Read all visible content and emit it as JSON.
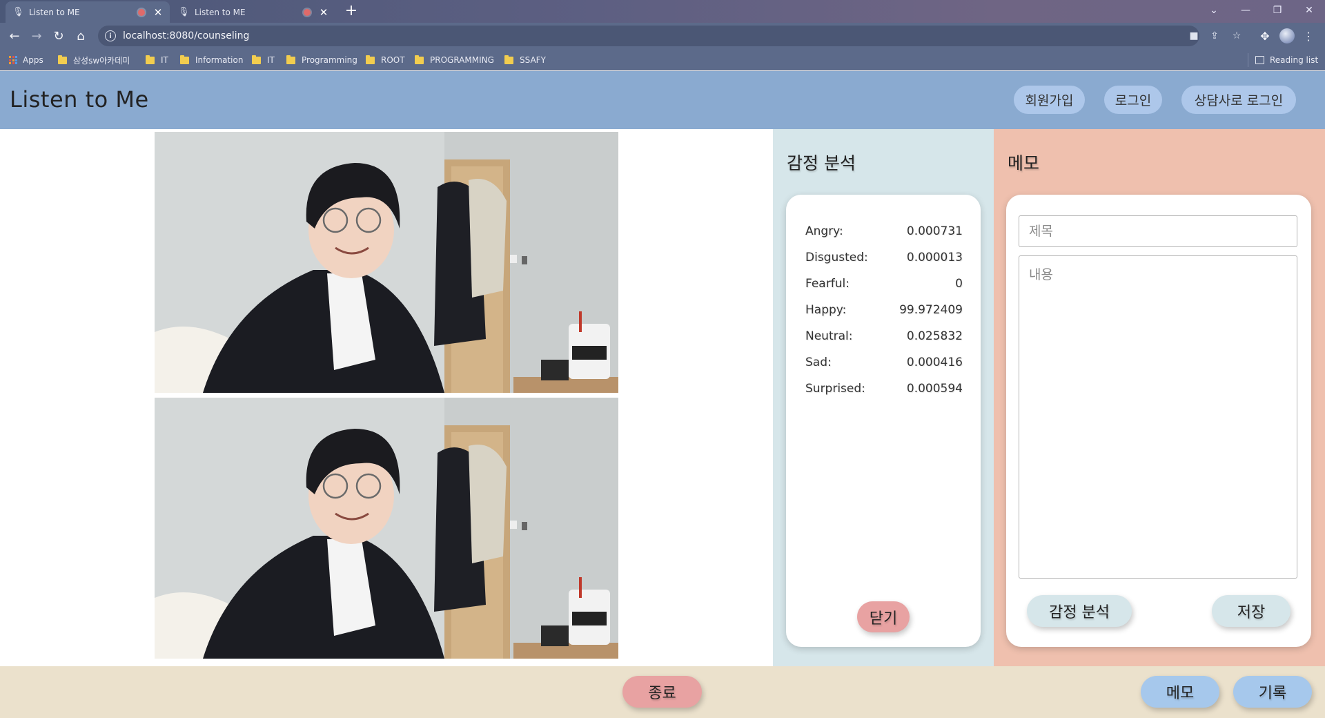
{
  "browser": {
    "tabs": [
      {
        "title": "Listen to ME",
        "active": true
      },
      {
        "title": "Listen to ME",
        "active": false
      }
    ],
    "url": "localhost:8080/counseling",
    "bookmarks": [
      {
        "label": "Apps",
        "type": "apps"
      },
      {
        "label": "삼성sw아카데미",
        "type": "folder"
      },
      {
        "label": "IT",
        "type": "folder"
      },
      {
        "label": "Information",
        "type": "folder"
      },
      {
        "label": "IT",
        "type": "folder"
      },
      {
        "label": "Programming",
        "type": "folder"
      },
      {
        "label": "ROOT",
        "type": "folder"
      },
      {
        "label": "PROGRAMMING",
        "type": "folder"
      },
      {
        "label": "SSAFY",
        "type": "folder"
      }
    ],
    "reading_list": "Reading list",
    "icons": {
      "back": "arrow-left-icon",
      "forward": "arrow-right-icon",
      "reload": "reload-icon",
      "home": "home-icon"
    }
  },
  "header": {
    "title": "Listen to Me",
    "signup_label": "회원가입",
    "login_label": "로그인",
    "counselor_login_label": "상담사로 로그인"
  },
  "emotion": {
    "title": "감정 분석",
    "rows": [
      {
        "label": "Angry:",
        "value": "0.000731"
      },
      {
        "label": "Disgusted:",
        "value": "0.000013"
      },
      {
        "label": "Fearful:",
        "value": "0"
      },
      {
        "label": "Happy:",
        "value": "99.972409"
      },
      {
        "label": "Neutral:",
        "value": "0.025832"
      },
      {
        "label": "Sad:",
        "value": "0.000416"
      },
      {
        "label": "Surprised:",
        "value": "0.000594"
      }
    ],
    "close_label": "닫기"
  },
  "memo": {
    "title": "메모",
    "title_placeholder": "제목",
    "content_placeholder": "내용",
    "analyze_label": "감정 분석",
    "save_label": "저장"
  },
  "footer": {
    "end_label": "종료",
    "memo_label": "메모",
    "record_label": "기록"
  },
  "colors": {
    "header_bg": "#8aaad0",
    "emotion_panel_bg": "#d6e6ea",
    "memo_panel_bg": "#efc0ae",
    "footer_bg": "#ebe1cc",
    "danger_pill": "#e8a2a2",
    "primary_pill": "#a6c8ec"
  }
}
